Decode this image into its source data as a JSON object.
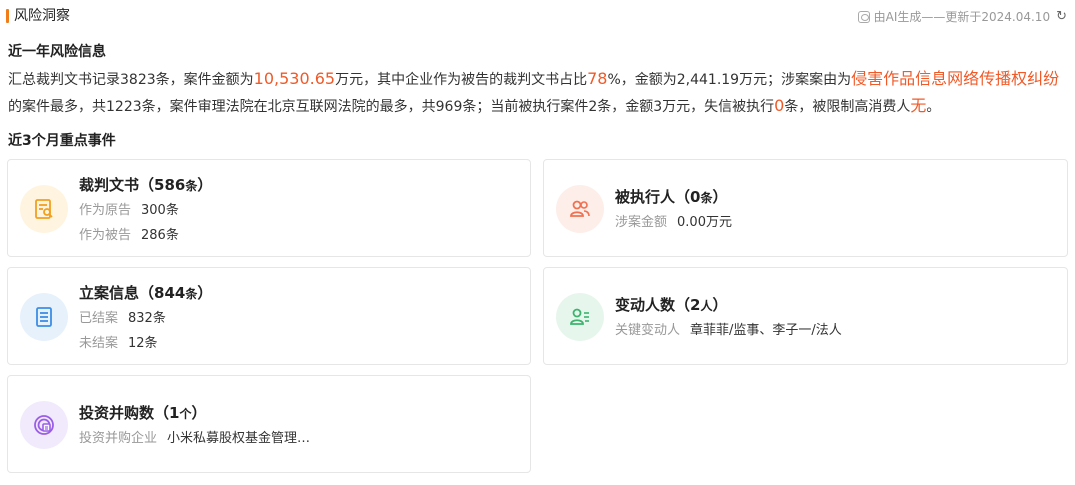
{
  "header": {
    "title": "风险洞察",
    "ai_note": "由AI生成——更新于2024.04.10",
    "refresh_icon": "refresh-icon"
  },
  "year_section": {
    "title": "近一年风险信息",
    "line1": {
      "p1": "汇总裁判文书记录3823条，案件金额为",
      "amount": "10,530.65",
      "p2": "万元，其中企业作为被告的裁判文书占比",
      "pct": "78",
      "p3": "%，金额为2,441.19万元；涉案案由为",
      "cause": "侵害作品信息网络传播权纠纷"
    },
    "line2": {
      "p1": "的案件最多，共1223条，案件审理法院在北京互联网法院的最多，共969条；当前被执行案件2条，金额3万元，失信被执行",
      "dishonest": "0",
      "p2": "条，被限制高消费人",
      "restricted": "无",
      "p3": "。"
    }
  },
  "events_section": {
    "title": "近3个月重点事件",
    "cards": {
      "judgment": {
        "title": "裁判文书（586",
        "unit": "条",
        "close": "）",
        "rows": [
          {
            "label": "作为原告",
            "value": "300条"
          },
          {
            "label": "作为被告",
            "value": "286条"
          }
        ]
      },
      "executed": {
        "title": "被执行人（0",
        "unit": "条",
        "close": "）",
        "rows": [
          {
            "label": "涉案金额",
            "value": "0.00万元"
          }
        ]
      },
      "filing": {
        "title": "立案信息（844",
        "unit": "条",
        "close": "）",
        "rows": [
          {
            "label": "已结案",
            "value": "832条"
          },
          {
            "label": "未结案",
            "value": "12条"
          }
        ]
      },
      "personnel": {
        "title": "变动人数（2",
        "unit": "人",
        "close": "）",
        "rows": [
          {
            "label": "关键变动人",
            "value": "章菲菲/监事、李子一/法人"
          }
        ]
      },
      "investment": {
        "title": "投资并购数（1",
        "unit": "个",
        "close": "）",
        "rows": [
          {
            "label": "投资并购企业",
            "value": "小米私募股权基金管理…"
          }
        ]
      }
    }
  },
  "colors": {
    "accent": "#f07d17",
    "highlight": "#f05a28",
    "judgment_icon": "#f0a020",
    "executed_icon": "#f07050",
    "filing_icon": "#3c8de6",
    "personnel_icon": "#3cb46e",
    "investment_icon": "#9a5ee6"
  }
}
